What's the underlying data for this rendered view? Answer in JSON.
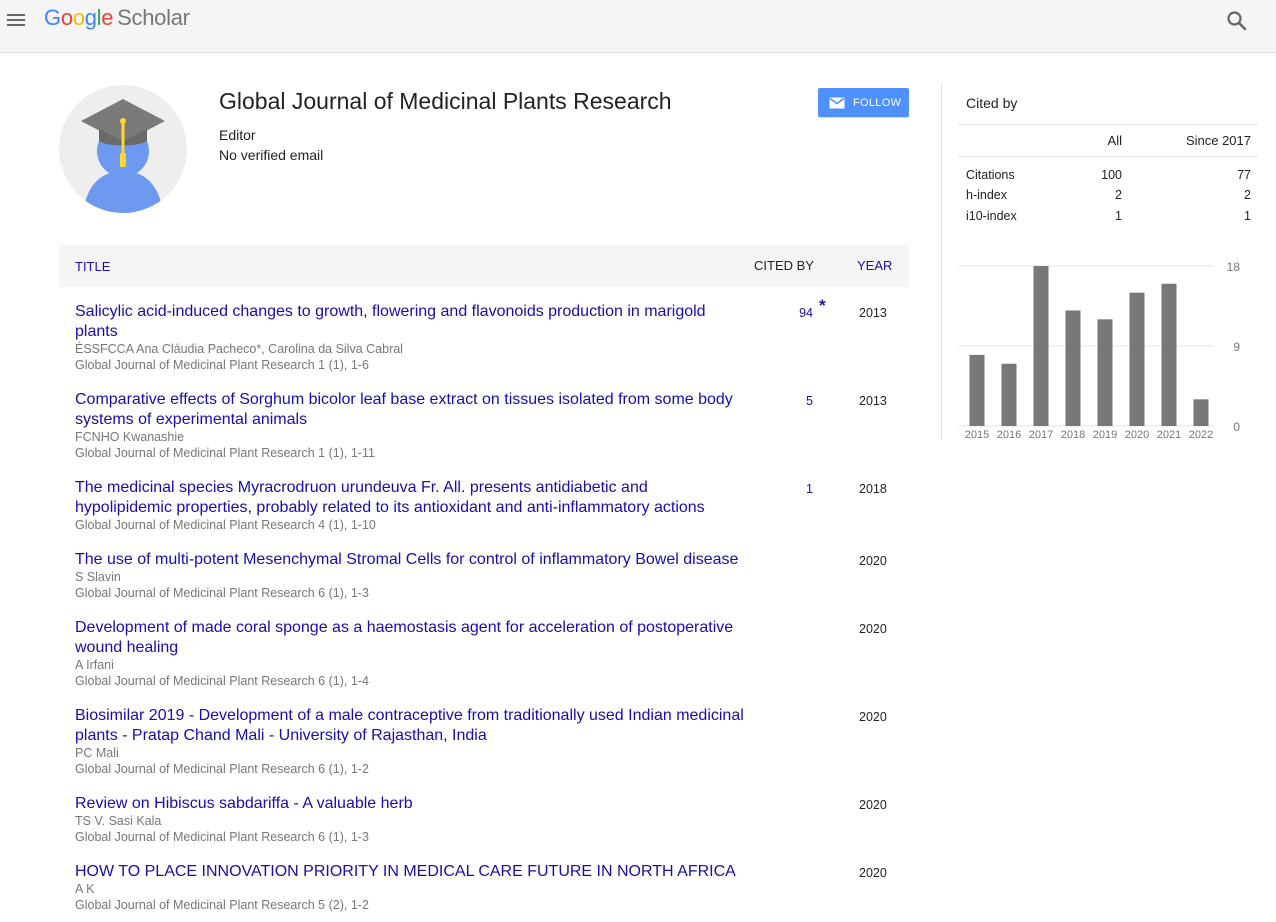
{
  "header": {
    "logo_google": [
      "G",
      "o",
      "o",
      "g",
      "l",
      "e"
    ],
    "logo_scholar": "Scholar"
  },
  "profile": {
    "name": "Global Journal of Medicinal Plants Research",
    "affiliation": "Editor",
    "email": "No verified email",
    "follow_label": "FOLLOW"
  },
  "table": {
    "col_title": "TITLE",
    "col_cited": "CITED BY",
    "col_year": "YEAR",
    "rows": [
      {
        "title": "Salicylic acid-induced changes to growth, flowering and flavonoids production in marigold plants",
        "authors": "ÉSSFCCA Ana Cláudia Pacheco*, Carolina da Silva Cabral",
        "venue": "Global Journal of Medicinal Plant Research 1 (1), 1-6",
        "cites": "94",
        "star": "*",
        "year": "2013"
      },
      {
        "title": "Comparative effects of Sorghum bicolor leaf base extract on tissues isolated from some body systems of experimental animals",
        "authors": "FCNHO Kwanashie",
        "venue": "Global Journal of Medicinal Plant Research 1 (1), 1-11",
        "cites": "5",
        "star": "",
        "year": "2013"
      },
      {
        "title": "The medicinal species Myracrodruon urundeuva Fr. All. presents antidiabetic and hypolipidemic properties, probably related to its antioxidant and anti-inflammatory actions",
        "authors": "",
        "venue": "Global Journal of Medicinal Plant Research 4 (1), 1-10",
        "cites": "1",
        "star": "",
        "year": "2018"
      },
      {
        "title": "The use of multi-potent Mesenchymal Stromal Cells for control of inflammatory Bowel disease",
        "authors": "S Slavin",
        "venue": "Global Journal of Medicinal Plant Research 6 (1), 1-3",
        "cites": "",
        "star": "",
        "year": "2020"
      },
      {
        "title": "Development of made coral sponge as a haemostasis agent for acceleration of postoperative wound healing",
        "authors": "A Irfani",
        "venue": "Global Journal of Medicinal Plant Research 6 (1), 1-4",
        "cites": "",
        "star": "",
        "year": "2020"
      },
      {
        "title": "Biosimilar 2019 - Development of a male contraceptive from traditionally used Indian medicinal plants - Pratap Chand Mali - University of Rajasthan, India",
        "authors": "PC Mali",
        "venue": "Global Journal of Medicinal Plant Research 6 (1), 1-2",
        "cites": "",
        "star": "",
        "year": "2020"
      },
      {
        "title": "Review on Hibiscus sabdariffa - A valuable herb",
        "authors": "TS V. Sasi Kala",
        "venue": "Global Journal of Medicinal Plant Research 6 (1), 1-3",
        "cites": "",
        "star": "",
        "year": "2020"
      },
      {
        "title": "HOW TO PLACE INNOVATION PRIORITY IN MEDICAL CARE FUTURE IN NORTH AFRICA",
        "authors": "A K",
        "venue": "Global Journal of Medicinal Plant Research 5 (2), 1-2",
        "cites": "",
        "star": "",
        "year": "2020"
      }
    ]
  },
  "cited_by": {
    "title": "Cited by",
    "col_all": "All",
    "col_since": "Since 2017",
    "stats": [
      {
        "label": "Citations",
        "all": "100",
        "since": "77"
      },
      {
        "label": "h-index",
        "all": "2",
        "since": "2"
      },
      {
        "label": "i10-index",
        "all": "1",
        "since": "1"
      }
    ]
  },
  "colors": {
    "link": "#1a0dab",
    "follow_button": "#4d90fe",
    "bar": "#777777"
  },
  "chart_data": {
    "type": "bar",
    "categories": [
      "2015",
      "2016",
      "2017",
      "2018",
      "2019",
      "2020",
      "2021",
      "2022"
    ],
    "values": [
      8,
      7,
      18,
      13,
      12,
      15,
      16,
      3
    ],
    "ylim": [
      0,
      18
    ],
    "yticks": [
      "0",
      "9",
      "18"
    ],
    "grid": true
  }
}
